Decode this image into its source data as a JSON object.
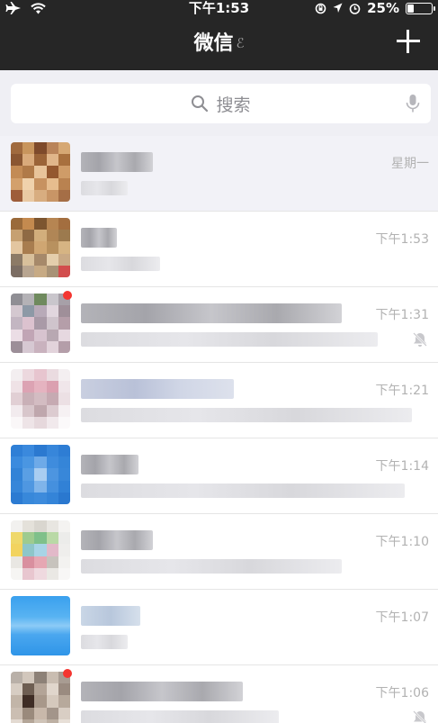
{
  "status_bar": {
    "time": "下午1:53",
    "battery_text": "25%",
    "battery_level": 0.25,
    "icons": [
      "airplane-icon",
      "wifi-icon",
      "rotation-lock-icon",
      "location-icon",
      "alarm-icon",
      "battery-icon"
    ]
  },
  "nav": {
    "title": "微信",
    "ear_glyph": "ℰ",
    "add_icon": "plus-icon"
  },
  "search": {
    "placeholder": "搜索",
    "left_icon": "magnifier-icon",
    "right_icon": "microphone-icon"
  },
  "chats": [
    {
      "time": "星期一",
      "pinned": true,
      "muted": false,
      "badge": false
    },
    {
      "time": "下午1:53",
      "pinned": false,
      "muted": false,
      "badge": false
    },
    {
      "time": "下午1:31",
      "pinned": false,
      "muted": true,
      "badge": true
    },
    {
      "time": "下午1:21",
      "pinned": false,
      "muted": false,
      "badge": false
    },
    {
      "time": "下午1:14",
      "pinned": false,
      "muted": false,
      "badge": false
    },
    {
      "time": "下午1:10",
      "pinned": false,
      "muted": false,
      "badge": false
    },
    {
      "time": "下午1:07",
      "pinned": false,
      "muted": false,
      "badge": false
    },
    {
      "time": "下午1:06",
      "pinned": false,
      "muted": true,
      "badge": true
    }
  ],
  "colors": {
    "bar_bg": "#262626",
    "search_bg": "#efeff4",
    "timestamp": "#b2b2b2",
    "badge": "#f43530"
  }
}
